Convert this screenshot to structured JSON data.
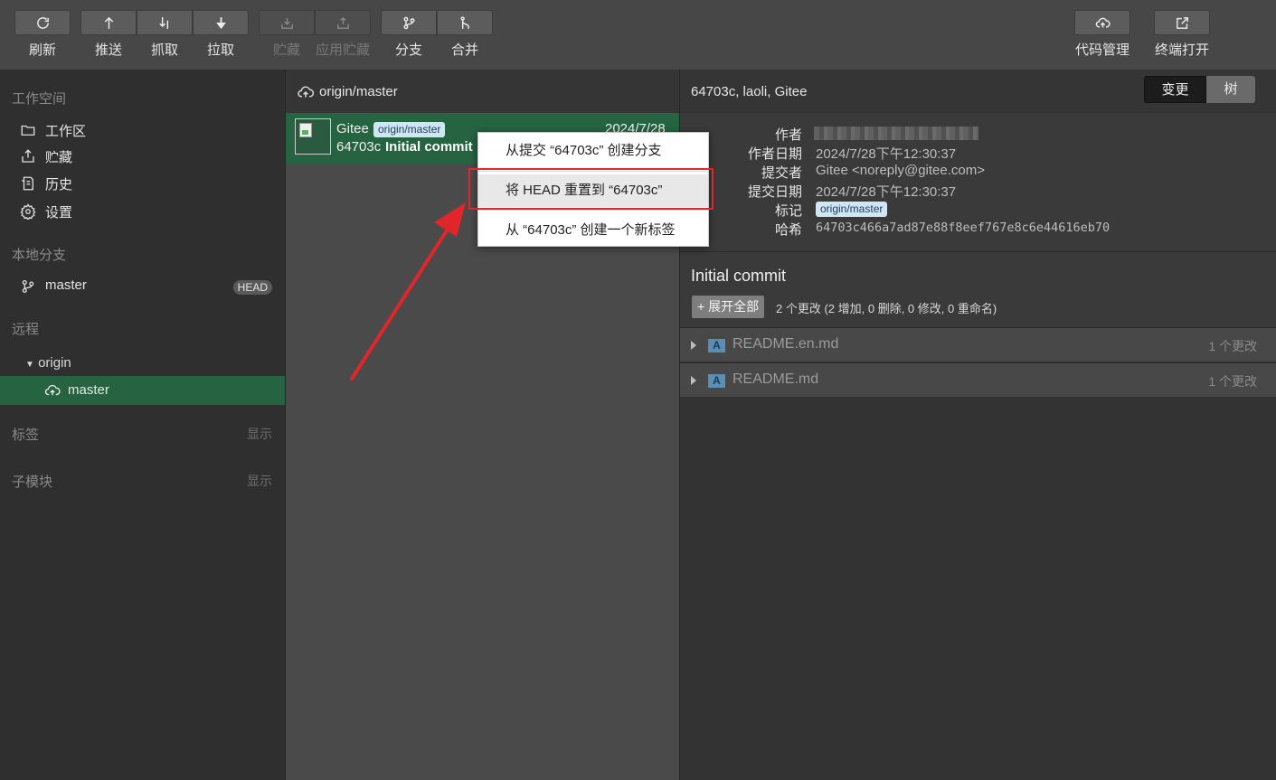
{
  "toolbar": {
    "refresh": "刷新",
    "push": "推送",
    "fetch": "抓取",
    "pull": "拉取",
    "stash": "贮藏",
    "apply_stash": "应用贮藏",
    "branch": "分支",
    "merge": "合并",
    "code_manage": "代码管理",
    "terminal_open": "终端打开"
  },
  "sidebar": {
    "workspace_title": "工作空间",
    "workspace_items": [
      {
        "label": "工作区",
        "icon": "folder-icon"
      },
      {
        "label": "贮藏",
        "icon": "stash-icon"
      },
      {
        "label": "历史",
        "icon": "history-icon"
      },
      {
        "label": "设置",
        "icon": "gear-icon"
      }
    ],
    "local_branches_title": "本地分支",
    "local_branch": {
      "label": "master",
      "badge": "HEAD"
    },
    "remote_title": "远程",
    "remote_name": "origin",
    "remote_branch": "master",
    "tags_title": "标签",
    "tags_show": "显示",
    "submodules_title": "子模块",
    "submodules_show": "显示"
  },
  "history": {
    "header": "origin/master",
    "commit": {
      "author": "Gitee",
      "ref_tag": "origin/master",
      "date": "2024/7/28",
      "hash": "64703c",
      "message": "Initial commit"
    }
  },
  "context_menu": {
    "items": [
      "从提交 “64703c” 创建分支",
      "将 HEAD 重置到 “64703c”",
      "从 “64703c” 创建一个新标签"
    ]
  },
  "details": {
    "header": "64703c, laoli, Gitee",
    "seg_changes": "变更",
    "seg_tree": "树",
    "labels": {
      "author": "作者",
      "author_date": "作者日期",
      "committer": "提交者",
      "commit_date": "提交日期",
      "tag": "标记",
      "hash": "哈希"
    },
    "author_date": "2024/7/28下午12:30:37",
    "committer": "Gitee <noreply@gitee.com>",
    "commit_date": "2024/7/28下午12:30:37",
    "tag": "origin/master",
    "hash": "64703c466a7ad87e88f8eef767e8c6e44616eb70",
    "commit_title": "Initial commit",
    "expand_all": "+ 展开全部",
    "stats": "2 个更改 (2 增加, 0 删除, 0 修改, 0 重命名)",
    "files": [
      {
        "status": "A",
        "name": "README.en.md",
        "changes": "1 个更改"
      },
      {
        "status": "A",
        "name": "README.md",
        "changes": "1 个更改"
      }
    ]
  },
  "colors": {
    "accent_green": "#256341",
    "highlight_red": "#e0262b",
    "tag_bg": "#cfe6f5"
  }
}
